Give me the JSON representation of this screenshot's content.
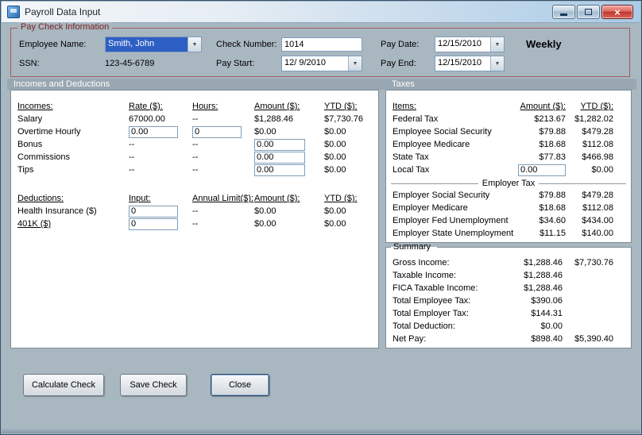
{
  "window": {
    "title": "Payroll Data Input",
    "close_glyph": "×",
    "dropdown_glyph": "▼"
  },
  "colors": {
    "form_background": "#a9b7c1",
    "selection_blue": "#2e5fc4",
    "group_border_red": "#a05f5a",
    "group_label_red": "#7a1f1f",
    "close_button_red": "#bf352c"
  },
  "pay_check_info": {
    "group_label": "Pay Check Information",
    "employee_name": {
      "label": "Employee Name:",
      "value": "Smith, John"
    },
    "ssn": {
      "label": "SSN:",
      "value": "123-45-6789"
    },
    "check_number": {
      "label": "Check Number:",
      "value": "1014"
    },
    "pay_start": {
      "label": "Pay Start:",
      "value": "12/ 9/2010"
    },
    "pay_date": {
      "label": "Pay Date:",
      "value": "12/15/2010"
    },
    "pay_end": {
      "label": "Pay End:",
      "value": "12/15/2010"
    },
    "frequency": "Weekly"
  },
  "section_headers": {
    "left": "Incomes and Deductions",
    "right": "Taxes"
  },
  "incomes": {
    "headers": {
      "name": "Incomes:",
      "rate": "Rate ($):",
      "hours": "Hours:",
      "amount": "Amount ($):",
      "ytd": "YTD ($):"
    },
    "salary": {
      "label": "Salary",
      "rate": "67000.00",
      "hours": "--",
      "amount": "$1,288.46",
      "ytd": "$7,730.76"
    },
    "overtime": {
      "label": "Overtime Hourly",
      "rate": "0.00",
      "hours": "0",
      "amount": "$0.00",
      "ytd": "$0.00"
    },
    "bonus": {
      "label": "Bonus",
      "rate": "--",
      "hours": "--",
      "amount": "0.00",
      "ytd": "$0.00"
    },
    "commissions": {
      "label": "Commissions",
      "rate": "--",
      "hours": "--",
      "amount": "0.00",
      "ytd": "$0.00"
    },
    "tips": {
      "label": "Tips",
      "rate": "--",
      "hours": "--",
      "amount": "0.00",
      "ytd": "$0.00"
    }
  },
  "deductions": {
    "headers": {
      "name": "Deductions:",
      "input": "Input:",
      "annual_limit": "Annual Limit($):",
      "amount": "Amount ($):",
      "ytd": "YTD ($):"
    },
    "health_insurance": {
      "label": "Health Insurance  ($)",
      "input": "0",
      "annual_limit": "--",
      "amount": "$0.00",
      "ytd": "$0.00"
    },
    "k401": {
      "label": "401K  ($)",
      "input": "0",
      "annual_limit": "--",
      "amount": "$0.00",
      "ytd": "$0.00"
    }
  },
  "taxes": {
    "headers": {
      "items": "Items:",
      "amount": "Amount ($):",
      "ytd": "YTD ($):"
    },
    "federal": {
      "label": "Federal Tax",
      "amount": "$213.67",
      "ytd": "$1,282.02"
    },
    "emp_ss": {
      "label": "Employee Social Security",
      "amount": "$79.88",
      "ytd": "$479.28"
    },
    "emp_medicare": {
      "label": "Employee Medicare",
      "amount": "$18.68",
      "ytd": "$112.08"
    },
    "state": {
      "label": "State Tax",
      "amount": "$77.83",
      "ytd": "$466.98"
    },
    "local": {
      "label": "Local Tax",
      "amount": "0.00",
      "ytd": "$0.00"
    },
    "employer_divider": "Employer Tax",
    "employer_ss": {
      "label": "Employer Social Security",
      "amount": "$79.88",
      "ytd": "$479.28"
    },
    "employer_medicare": {
      "label": "Employer Medicare",
      "amount": "$18.68",
      "ytd": "$112.08"
    },
    "employer_fed_unemp": {
      "label": "Employer Fed Unemployment",
      "amount": "$34.60",
      "ytd": "$434.00"
    },
    "employer_state_unemp": {
      "label": "Employer State Unemployment",
      "amount": "$11.15",
      "ytd": "$140.00"
    }
  },
  "summary": {
    "group_label": "Summary",
    "gross_income": {
      "label": "Gross Income:",
      "amount": "$1,288.46",
      "ytd": "$7,730.76"
    },
    "taxable_income": {
      "label": "Taxable Income:",
      "amount": "$1,288.46",
      "ytd": ""
    },
    "fica_taxable": {
      "label": "FICA Taxable Income:",
      "amount": "$1,288.46",
      "ytd": ""
    },
    "total_employee_tax": {
      "label": "Total Employee Tax:",
      "amount": "$390.06",
      "ytd": ""
    },
    "total_employer_tax": {
      "label": "Total Employer Tax:",
      "amount": "$144.31",
      "ytd": ""
    },
    "total_deduction": {
      "label": "Total Deduction:",
      "amount": "$0.00",
      "ytd": ""
    },
    "net_pay": {
      "label": "Net Pay:",
      "amount": "$898.40",
      "ytd": "$5,390.40"
    }
  },
  "buttons": {
    "calculate": "Calculate Check",
    "save": "Save Check",
    "close": "Close"
  }
}
